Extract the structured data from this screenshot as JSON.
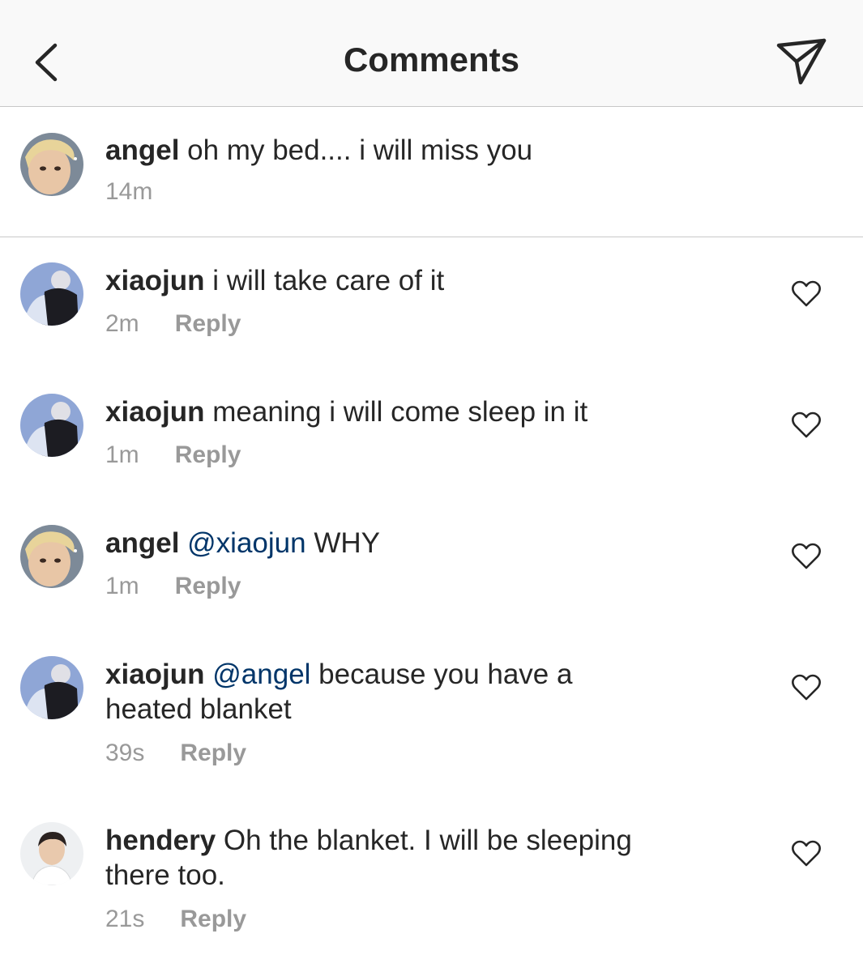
{
  "header": {
    "title": "Comments",
    "back_icon": "chevron-left-icon",
    "send_icon": "paper-plane-icon"
  },
  "caption": {
    "username": "angel",
    "text": "oh my bed.... i will miss you",
    "time": "14m"
  },
  "comments": [
    {
      "username": "xiaojun",
      "mention": "",
      "text": "i will take care of it",
      "text_line2": "",
      "time": "2m",
      "reply": "Reply"
    },
    {
      "username": "xiaojun",
      "mention": "",
      "text": "meaning i will come sleep in it",
      "text_line2": "",
      "time": "1m",
      "reply": "Reply"
    },
    {
      "username": "angel",
      "mention": "@xiaojun",
      "text": "WHY",
      "text_line2": "",
      "time": "1m",
      "reply": "Reply"
    },
    {
      "username": "xiaojun",
      "mention": "@angel",
      "text": "because you have a",
      "text_line2": "heated blanket",
      "time": "39s",
      "reply": "Reply"
    },
    {
      "username": "hendery",
      "mention": "",
      "text": "Oh the blanket. I will be sleeping",
      "text_line2": "there too.",
      "time": "21s",
      "reply": "Reply"
    }
  ],
  "colors": {
    "text": "#262626",
    "meta": "#999999",
    "mention": "#003569",
    "header_bg": "#f9f9f9",
    "divider": "#c8c8c8"
  }
}
